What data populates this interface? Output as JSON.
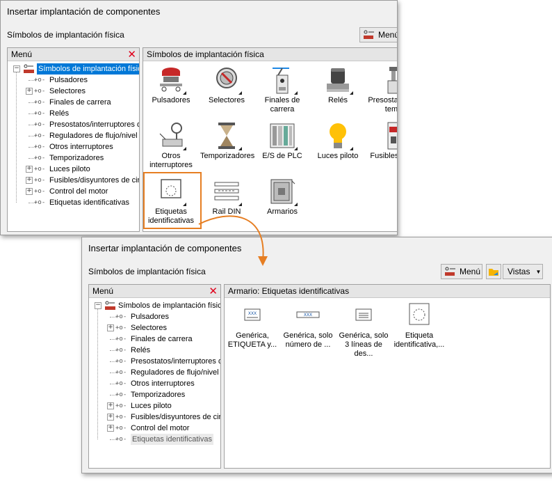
{
  "window1": {
    "title": "Insertar implantación de componentes",
    "subheader": "Símbolos de implantación física",
    "menu_button": "Menú",
    "menu_panel_title": "Menú",
    "content_title": "Símbolos de implantación física",
    "tree_root": "Símbolos de implantación física",
    "tree_items": [
      {
        "label": "Pulsadores",
        "expandable": false
      },
      {
        "label": "Selectores",
        "expandable": true
      },
      {
        "label": "Finales de carrera",
        "expandable": false
      },
      {
        "label": "Relés",
        "expandable": false
      },
      {
        "label": "Presostatos/interruptores de",
        "expandable": false
      },
      {
        "label": "Reguladores de flujo/nivel",
        "expandable": false
      },
      {
        "label": "Otros interruptores",
        "expandable": false
      },
      {
        "label": "Temporizadores",
        "expandable": false
      },
      {
        "label": "Luces piloto",
        "expandable": true
      },
      {
        "label": "Fusibles/disyuntores de circ",
        "expandable": true
      },
      {
        "label": "Control del motor",
        "expandable": true
      },
      {
        "label": "Etiquetas identificativas",
        "expandable": false
      }
    ],
    "grid_items": [
      {
        "label": "Pulsadores",
        "icon": "pushbutton-icon"
      },
      {
        "label": "Selectores",
        "icon": "selector-icon"
      },
      {
        "label": "Finales de carrera",
        "icon": "limit-switch-icon"
      },
      {
        "label": "Relés",
        "icon": "relay-icon"
      },
      {
        "label": "Presostatos de temp",
        "icon": "pressure-switch-icon"
      },
      {
        "label": "Otros interruptores",
        "icon": "other-switch-icon"
      },
      {
        "label": "Temporizadores",
        "icon": "hourglass-icon"
      },
      {
        "label": "E/S de PLC",
        "icon": "plc-icon"
      },
      {
        "label": "Luces piloto",
        "icon": "lightbulb-icon"
      },
      {
        "label": "Fusibles de ci",
        "icon": "fuse-icon"
      },
      {
        "label": "Etiquetas identificativas",
        "icon": "nameplate-icon"
      },
      {
        "label": "Rail DIN",
        "icon": "din-rail-icon"
      },
      {
        "label": "Armarios",
        "icon": "cabinet-icon"
      }
    ]
  },
  "window2": {
    "title": "Insertar implantación de componentes",
    "subheader": "Símbolos de implantación física",
    "menu_button": "Menú",
    "views_button": "Vistas",
    "menu_panel_title": "Menú",
    "content_title": "Armario: Etiquetas identificativas",
    "tree_root": "Símbolos de implantación física",
    "tree_items": [
      {
        "label": "Pulsadores",
        "expandable": false
      },
      {
        "label": "Selectores",
        "expandable": true
      },
      {
        "label": "Finales de carrera",
        "expandable": false
      },
      {
        "label": "Relés",
        "expandable": false
      },
      {
        "label": "Presostatos/interruptores d",
        "expandable": false
      },
      {
        "label": "Reguladores de flujo/nivel",
        "expandable": false
      },
      {
        "label": "Otros interruptores",
        "expandable": false
      },
      {
        "label": "Temporizadores",
        "expandable": false
      },
      {
        "label": "Luces piloto",
        "expandable": true
      },
      {
        "label": "Fusibles/disyuntores de cir",
        "expandable": true
      },
      {
        "label": "Control del motor",
        "expandable": true
      },
      {
        "label": "Etiquetas identificativas",
        "expandable": false
      }
    ],
    "grid_items": [
      {
        "label": "Genérica, ETIQUETA y...",
        "icon": "nameplate-generic-icon",
        "badge": "XXX"
      },
      {
        "label": "Genérica, solo número de ...",
        "icon": "nameplate-number-icon",
        "badge": "XXX"
      },
      {
        "label": "Genérica, solo 3 líneas de des...",
        "icon": "nameplate-lines-icon",
        "badge": ""
      },
      {
        "label": "Etiqueta identificativa,...",
        "icon": "nameplate-round-icon",
        "badge": ""
      }
    ]
  },
  "colors": {
    "accent": "#0078d7",
    "highlight": "#e67e22",
    "close": "#e0001b"
  }
}
